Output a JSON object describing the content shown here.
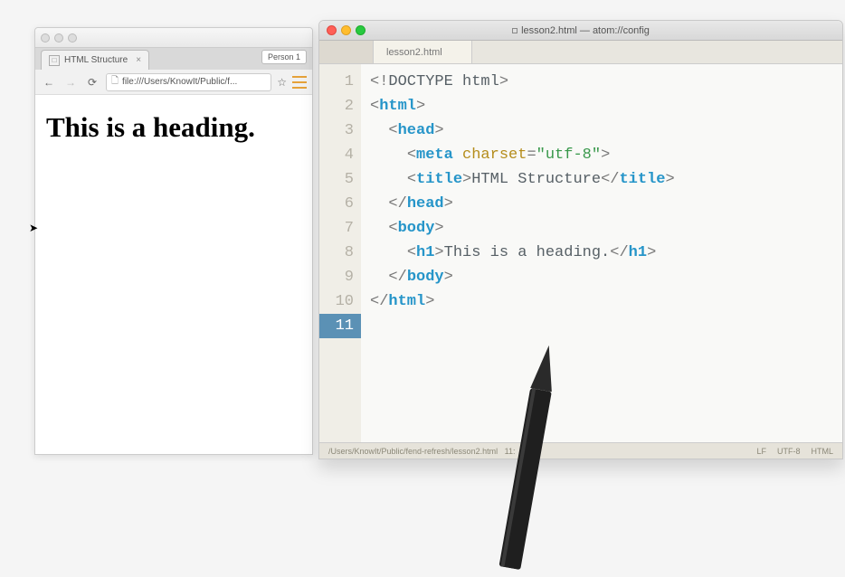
{
  "browser": {
    "tab_title": "HTML Structure",
    "profile_label": "Person 1",
    "url": "file:///Users/KnowIt/Public/f...",
    "heading": "This is a heading."
  },
  "editor": {
    "window_title": "lesson2.html — atom://config",
    "tab_label": "lesson2.html",
    "line_numbers": [
      "1",
      "2",
      "3",
      "4",
      "5",
      "6",
      "7",
      "8",
      "9",
      "10",
      "11"
    ],
    "active_line": "11",
    "code": {
      "l1_doctype": "DOCTYPE html",
      "tag_html": "html",
      "tag_head": "head",
      "tag_meta": "meta",
      "attr_charset": "charset",
      "val_charset": "\"utf-8\"",
      "tag_title": "title",
      "title_text": "HTML Structure",
      "tag_body": "body",
      "tag_h1": "h1",
      "h1_text": "This is a heading."
    },
    "status": {
      "path": "/Users/KnowIt/Public/fend-refresh/lesson2.html",
      "cursor": "11:",
      "line_ending": "LF",
      "encoding": "UTF-8",
      "language": "HTML"
    }
  }
}
